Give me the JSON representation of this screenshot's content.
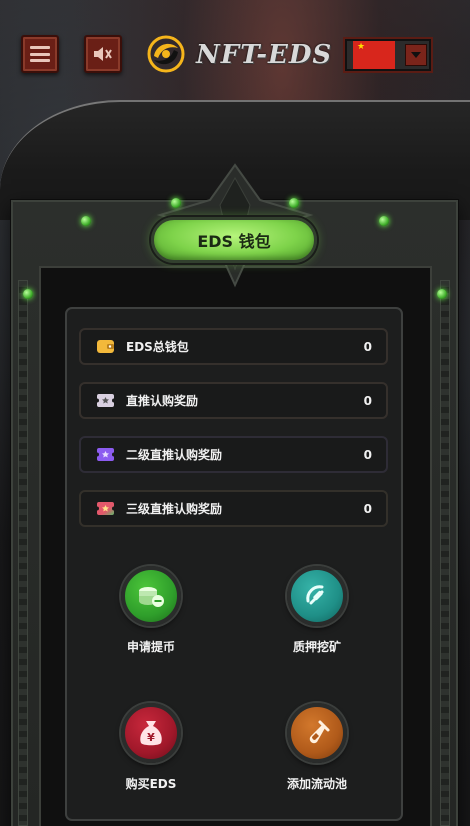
{
  "header": {
    "brand": "NFT-EDS",
    "language": {
      "icon": "china-flag-icon"
    },
    "icons": {
      "menu": "menu-icon",
      "sound": "sound-off-icon"
    }
  },
  "wallet": {
    "title": "EDS 钱包",
    "accent": "#7ed34a",
    "rows": [
      {
        "label": "EDS总钱包",
        "value": "0",
        "icon": "wallet-icon",
        "color": "#f3b93b"
      },
      {
        "label": "直推认购奖励",
        "value": "0",
        "icon": "ticket-icon",
        "color": "#d9d0e0"
      },
      {
        "label": "二级直推认购奖励",
        "value": "0",
        "icon": "ticket-icon",
        "color": "#8c5cf0"
      },
      {
        "label": "三级直推认购奖励",
        "value": "0",
        "icon": "ticket-icon",
        "color": "#e3586b"
      }
    ]
  },
  "actions": [
    {
      "label": "申请提币",
      "icon": "coins-icon",
      "color": "#2f9e2b"
    },
    {
      "label": "质押挖矿",
      "icon": "pickaxe-icon",
      "color": "#1f8f87"
    },
    {
      "label": "购买EDS",
      "icon": "money-bag-icon",
      "color": "#a0182a"
    },
    {
      "label": "添加流动池",
      "icon": "vial-icon",
      "color": "#b05a1a"
    }
  ]
}
